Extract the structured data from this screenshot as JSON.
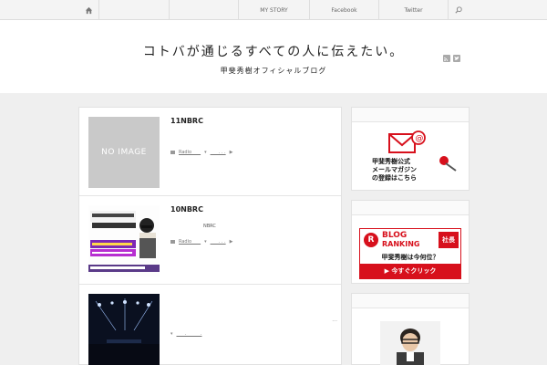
{
  "nav": {
    "items": [
      "MY STORY",
      "Facebook",
      "Twitter"
    ]
  },
  "header": {
    "title": "コトバが通じるすべての人に伝えたい。",
    "subtitle": "甲斐秀樹オフィシャルブログ"
  },
  "posts": [
    {
      "title": "11NBRC",
      "thumbnail_text": "NO IMAGE",
      "category": "Radio____",
      "tag": "___ . . .",
      "excerpt": ""
    },
    {
      "title": "10NBRC",
      "thumbnail_text": "",
      "category": "Radio____",
      "tag": "___ . . .",
      "excerpt": "NBRC"
    },
    {
      "title": "",
      "thumbnail_text": "",
      "category": "",
      "tag": "___ . _____ .",
      "excerpt": "",
      "more": "..."
    }
  ],
  "sidebar": {
    "mail_banner": {
      "line1": "甲斐秀樹公式",
      "line2": "メールマガジン",
      "line3": "の登録はこちら"
    },
    "ranking_banner": {
      "label_blog": "BLOG",
      "label_ranking": "RANKING",
      "badge": "社長",
      "question": "甲斐秀樹は今何位？",
      "cta": "▶ 今すぐクリック"
    }
  },
  "colors": {
    "accent_red": "#d7101c",
    "nav_bg": "#f4f4f4",
    "page_bg": "#efefef"
  }
}
